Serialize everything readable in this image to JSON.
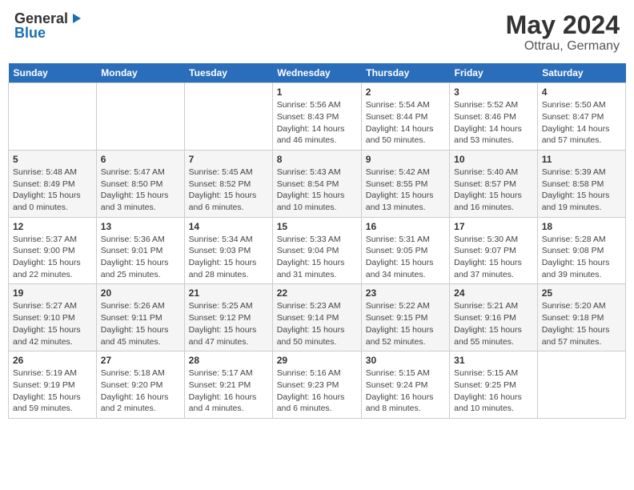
{
  "header": {
    "logo_general": "General",
    "logo_blue": "Blue",
    "month": "May 2024",
    "location": "Ottrau, Germany"
  },
  "days_of_week": [
    "Sunday",
    "Monday",
    "Tuesday",
    "Wednesday",
    "Thursday",
    "Friday",
    "Saturday"
  ],
  "weeks": [
    [
      {
        "day": "",
        "details": ""
      },
      {
        "day": "",
        "details": ""
      },
      {
        "day": "",
        "details": ""
      },
      {
        "day": "1",
        "details": "Sunrise: 5:56 AM\nSunset: 8:43 PM\nDaylight: 14 hours\nand 46 minutes."
      },
      {
        "day": "2",
        "details": "Sunrise: 5:54 AM\nSunset: 8:44 PM\nDaylight: 14 hours\nand 50 minutes."
      },
      {
        "day": "3",
        "details": "Sunrise: 5:52 AM\nSunset: 8:46 PM\nDaylight: 14 hours\nand 53 minutes."
      },
      {
        "day": "4",
        "details": "Sunrise: 5:50 AM\nSunset: 8:47 PM\nDaylight: 14 hours\nand 57 minutes."
      }
    ],
    [
      {
        "day": "5",
        "details": "Sunrise: 5:48 AM\nSunset: 8:49 PM\nDaylight: 15 hours\nand 0 minutes."
      },
      {
        "day": "6",
        "details": "Sunrise: 5:47 AM\nSunset: 8:50 PM\nDaylight: 15 hours\nand 3 minutes."
      },
      {
        "day": "7",
        "details": "Sunrise: 5:45 AM\nSunset: 8:52 PM\nDaylight: 15 hours\nand 6 minutes."
      },
      {
        "day": "8",
        "details": "Sunrise: 5:43 AM\nSunset: 8:54 PM\nDaylight: 15 hours\nand 10 minutes."
      },
      {
        "day": "9",
        "details": "Sunrise: 5:42 AM\nSunset: 8:55 PM\nDaylight: 15 hours\nand 13 minutes."
      },
      {
        "day": "10",
        "details": "Sunrise: 5:40 AM\nSunset: 8:57 PM\nDaylight: 15 hours\nand 16 minutes."
      },
      {
        "day": "11",
        "details": "Sunrise: 5:39 AM\nSunset: 8:58 PM\nDaylight: 15 hours\nand 19 minutes."
      }
    ],
    [
      {
        "day": "12",
        "details": "Sunrise: 5:37 AM\nSunset: 9:00 PM\nDaylight: 15 hours\nand 22 minutes."
      },
      {
        "day": "13",
        "details": "Sunrise: 5:36 AM\nSunset: 9:01 PM\nDaylight: 15 hours\nand 25 minutes."
      },
      {
        "day": "14",
        "details": "Sunrise: 5:34 AM\nSunset: 9:03 PM\nDaylight: 15 hours\nand 28 minutes."
      },
      {
        "day": "15",
        "details": "Sunrise: 5:33 AM\nSunset: 9:04 PM\nDaylight: 15 hours\nand 31 minutes."
      },
      {
        "day": "16",
        "details": "Sunrise: 5:31 AM\nSunset: 9:05 PM\nDaylight: 15 hours\nand 34 minutes."
      },
      {
        "day": "17",
        "details": "Sunrise: 5:30 AM\nSunset: 9:07 PM\nDaylight: 15 hours\nand 37 minutes."
      },
      {
        "day": "18",
        "details": "Sunrise: 5:28 AM\nSunset: 9:08 PM\nDaylight: 15 hours\nand 39 minutes."
      }
    ],
    [
      {
        "day": "19",
        "details": "Sunrise: 5:27 AM\nSunset: 9:10 PM\nDaylight: 15 hours\nand 42 minutes."
      },
      {
        "day": "20",
        "details": "Sunrise: 5:26 AM\nSunset: 9:11 PM\nDaylight: 15 hours\nand 45 minutes."
      },
      {
        "day": "21",
        "details": "Sunrise: 5:25 AM\nSunset: 9:12 PM\nDaylight: 15 hours\nand 47 minutes."
      },
      {
        "day": "22",
        "details": "Sunrise: 5:23 AM\nSunset: 9:14 PM\nDaylight: 15 hours\nand 50 minutes."
      },
      {
        "day": "23",
        "details": "Sunrise: 5:22 AM\nSunset: 9:15 PM\nDaylight: 15 hours\nand 52 minutes."
      },
      {
        "day": "24",
        "details": "Sunrise: 5:21 AM\nSunset: 9:16 PM\nDaylight: 15 hours\nand 55 minutes."
      },
      {
        "day": "25",
        "details": "Sunrise: 5:20 AM\nSunset: 9:18 PM\nDaylight: 15 hours\nand 57 minutes."
      }
    ],
    [
      {
        "day": "26",
        "details": "Sunrise: 5:19 AM\nSunset: 9:19 PM\nDaylight: 15 hours\nand 59 minutes."
      },
      {
        "day": "27",
        "details": "Sunrise: 5:18 AM\nSunset: 9:20 PM\nDaylight: 16 hours\nand 2 minutes."
      },
      {
        "day": "28",
        "details": "Sunrise: 5:17 AM\nSunset: 9:21 PM\nDaylight: 16 hours\nand 4 minutes."
      },
      {
        "day": "29",
        "details": "Sunrise: 5:16 AM\nSunset: 9:23 PM\nDaylight: 16 hours\nand 6 minutes."
      },
      {
        "day": "30",
        "details": "Sunrise: 5:15 AM\nSunset: 9:24 PM\nDaylight: 16 hours\nand 8 minutes."
      },
      {
        "day": "31",
        "details": "Sunrise: 5:15 AM\nSunset: 9:25 PM\nDaylight: 16 hours\nand 10 minutes."
      },
      {
        "day": "",
        "details": ""
      }
    ]
  ]
}
